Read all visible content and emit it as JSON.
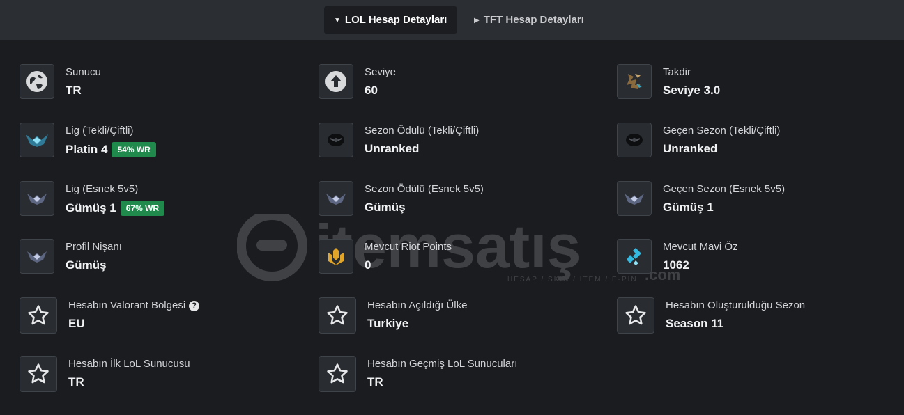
{
  "tabs": [
    {
      "label": "LOL Hesap Detayları",
      "active": true
    },
    {
      "label": "TFT Hesap Detayları",
      "active": false
    }
  ],
  "watermark": {
    "brand": "itemsatış",
    "tagline": "HESAP / SKIN / ITEM / E-PIN",
    "suffix": ".com"
  },
  "items": {
    "sunucu": {
      "label": "Sunucu",
      "value": "TR",
      "icon": "globe-icon"
    },
    "seviye": {
      "label": "Seviye",
      "value": "60",
      "icon": "arrow-up-circle-icon"
    },
    "takdir": {
      "label": "Takdir",
      "value": "Seviye 3.0",
      "icon": "honor-emblem-icon"
    },
    "lig_tekli": {
      "label": "Lig (Tekli/Çiftli)",
      "value": "Platin 4",
      "badge": "54% WR",
      "icon": "platinum-rank-icon"
    },
    "sezon_tekli": {
      "label": "Sezon Ödülü (Tekli/Çiftli)",
      "value": "Unranked",
      "icon": "unranked-emblem-icon"
    },
    "gecen_tekli": {
      "label": "Geçen Sezon (Tekli/Çiftli)",
      "value": "Unranked",
      "icon": "unranked-emblem-icon"
    },
    "lig_esnek": {
      "label": "Lig (Esnek 5v5)",
      "value": "Gümüş 1",
      "badge": "67% WR",
      "icon": "silver-rank-icon"
    },
    "sezon_esnek": {
      "label": "Sezon Ödülü (Esnek 5v5)",
      "value": "Gümüş",
      "icon": "silver-rank-icon"
    },
    "gecen_esnek": {
      "label": "Geçen Sezon (Esnek 5v5)",
      "value": "Gümüş 1",
      "icon": "silver-rank-icon"
    },
    "profil_nisani": {
      "label": "Profil Nişanı",
      "value": "Gümüş",
      "icon": "silver-rank-icon"
    },
    "riot_points": {
      "label": "Mevcut Riot Points",
      "value": "0",
      "icon": "riot-points-icon"
    },
    "mavi_oz": {
      "label": "Mevcut Mavi Öz",
      "value": "1062",
      "icon": "blue-essence-icon"
    },
    "valorant_bolge": {
      "label": "Hesabın Valorant Bölgesi",
      "value": "EU",
      "help": "?",
      "icon": "star-icon"
    },
    "acildigi_ulke": {
      "label": "Hesabın Açıldığı Ülke",
      "value": "Turkiye",
      "icon": "star-icon"
    },
    "olusturuldugu_sezon": {
      "label": "Hesabın Oluşturulduğu Sezon",
      "value": "Season 11",
      "icon": "star-icon"
    },
    "ilk_sunucu": {
      "label": "Hesabın İlk LoL Sunucusu",
      "value": "TR",
      "icon": "star-icon"
    },
    "gecmis_sunucular": {
      "label": "Hesabın Geçmiş LoL Sunucuları",
      "value": "TR",
      "icon": "star-icon"
    }
  },
  "colors": {
    "background": "#1a1c20",
    "tab_bar": "#2b2e33",
    "badge": "#1f8a4c",
    "riot_points": "#e2a528",
    "blue_essence": "#35b9e0"
  }
}
